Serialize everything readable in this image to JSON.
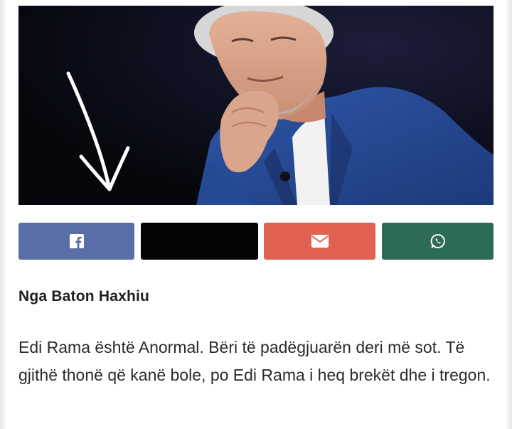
{
  "colors": {
    "facebook": "#5a6fa8",
    "twitter": "#050505",
    "email": "#e06151",
    "whatsapp": "#2d6b58"
  },
  "share_bar": {
    "buttons": [
      {
        "network": "facebook",
        "icon": "facebook-icon"
      },
      {
        "network": "twitter",
        "icon": ""
      },
      {
        "network": "email",
        "icon": "envelope-icon"
      },
      {
        "network": "whatsapp",
        "icon": "whatsapp-icon"
      }
    ]
  },
  "article": {
    "author": "Nga Baton Haxhiu",
    "body": "Edi Rama është Anormal. Bëri të padëgjuarën deri më sot. Të gjithë thonë që kanë bole, po Edi Rama i heq brekët dhe i tregon."
  }
}
